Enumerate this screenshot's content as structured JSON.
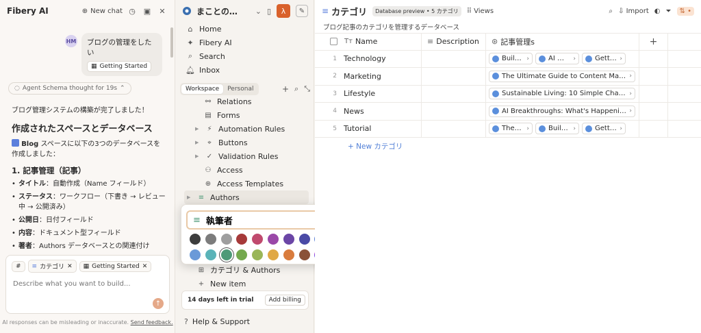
{
  "colors": {
    "accent": "#d9612b",
    "link": "#4f7ed6",
    "relation_dot": "#5b8fdc"
  },
  "ai_panel": {
    "title": "Fibery AI",
    "new_chat_label": "New chat",
    "user_initials": "HM",
    "user_message": "ブログの管理をしたい",
    "attachment_label": "Getting Started",
    "thought_label": "Agent Schema thought for 19s",
    "content": {
      "intro": "ブログ管理システムの構築が完了しました！",
      "heading": "作成されたスペースとデータベース",
      "space_name": "Blog",
      "space_text": "スペースに以下の3つのデータベースを作成しました：",
      "db1_title": "1. 記事管理（記事）",
      "bullets": [
        {
          "label": "タイトル",
          "text": "：自動作成（Name フィールド）"
        },
        {
          "label": "ステータス",
          "text": "：ワークフロー（下書き → レビュー中 → 公開済み）"
        },
        {
          "label": "公開日",
          "text": "：日付フィールド"
        },
        {
          "label": "内容",
          "text": "：ドキュメント型フィールド"
        },
        {
          "label": "著者",
          "text": "：Authors データベースとの関連付け"
        }
      ]
    },
    "chat": {
      "chips": [
        "カテゴリ",
        "Getting Started"
      ],
      "placeholder": "Describe what you want to build...",
      "hash": "#"
    },
    "disclaimer": "AI responses can be misleading or inaccurate.",
    "disclaimer_link": "Send feedback."
  },
  "nav": {
    "workspace_name": "まことの…",
    "avatar_letter": "λ",
    "items": [
      "Home",
      "Fibery AI",
      "Search",
      "Inbox"
    ],
    "tabs": [
      "Workspace",
      "Personal"
    ],
    "tree": [
      {
        "label": "Relations",
        "icon": "⚯"
      },
      {
        "label": "Forms",
        "icon": "▤"
      },
      {
        "label": "Automation Rules",
        "icon": "⚡"
      },
      {
        "label": "Buttons",
        "icon": "⌖"
      },
      {
        "label": "Validation Rules",
        "icon": "✓"
      },
      {
        "label": "Access",
        "icon": "👥"
      },
      {
        "label": "Access Templates",
        "icon": "⊕"
      },
      {
        "label": "Authors",
        "icon": "≡"
      }
    ],
    "tree_bottom": [
      {
        "label": "カテゴリ & Authors",
        "icon": "⊞"
      },
      {
        "label": "New item",
        "icon": "+"
      }
    ],
    "trial_text": "14 days left in trial",
    "billing_label": "Add billing",
    "help_label": "Help & Support"
  },
  "rename_popup": {
    "value": "執筆者",
    "swatches": [
      "#3d3d3d",
      "#7c7c7c",
      "#9e9e9e",
      "#a63a3a",
      "#c04a6e",
      "#9a48a8",
      "#6b46a6",
      "#4a4aa6",
      "#5a7fd6",
      "#6a9ad8",
      "#5ab3b8",
      "#4e9a78",
      "#74a94e",
      "#9ab658",
      "#e0a845",
      "#d97c3d",
      "#8a5238",
      "rainbow"
    ],
    "selected_swatch": 11
  },
  "database": {
    "title": "カテゴリ",
    "badge": "Database preview • 5 カテゴリ",
    "views_label": "Views",
    "import_label": "Import",
    "sort_label": "⇅ •",
    "description": "ブログ記事のカテゴリを管理するデータベース",
    "columns": [
      "Name",
      "Description",
      "記事管理s",
      "+"
    ],
    "rows": [
      {
        "num": "1",
        "name": "Technology",
        "rels": [
          "Buil…",
          "AI …",
          "Getti…"
        ]
      },
      {
        "num": "2",
        "name": "Marketing",
        "rels": [
          "The Ultimate Guide to Content Mar…"
        ]
      },
      {
        "num": "3",
        "name": "Lifestyle",
        "rels": [
          "Sustainable Living: 10 Simple Chan…"
        ]
      },
      {
        "num": "4",
        "name": "News",
        "rels": [
          "AI Breakthroughs: What's Happeni…"
        ]
      },
      {
        "num": "5",
        "name": "Tutorial",
        "rels": [
          "The…",
          "Buil…",
          "Getti…"
        ]
      }
    ],
    "new_row_label": "+  New カテゴリ"
  }
}
